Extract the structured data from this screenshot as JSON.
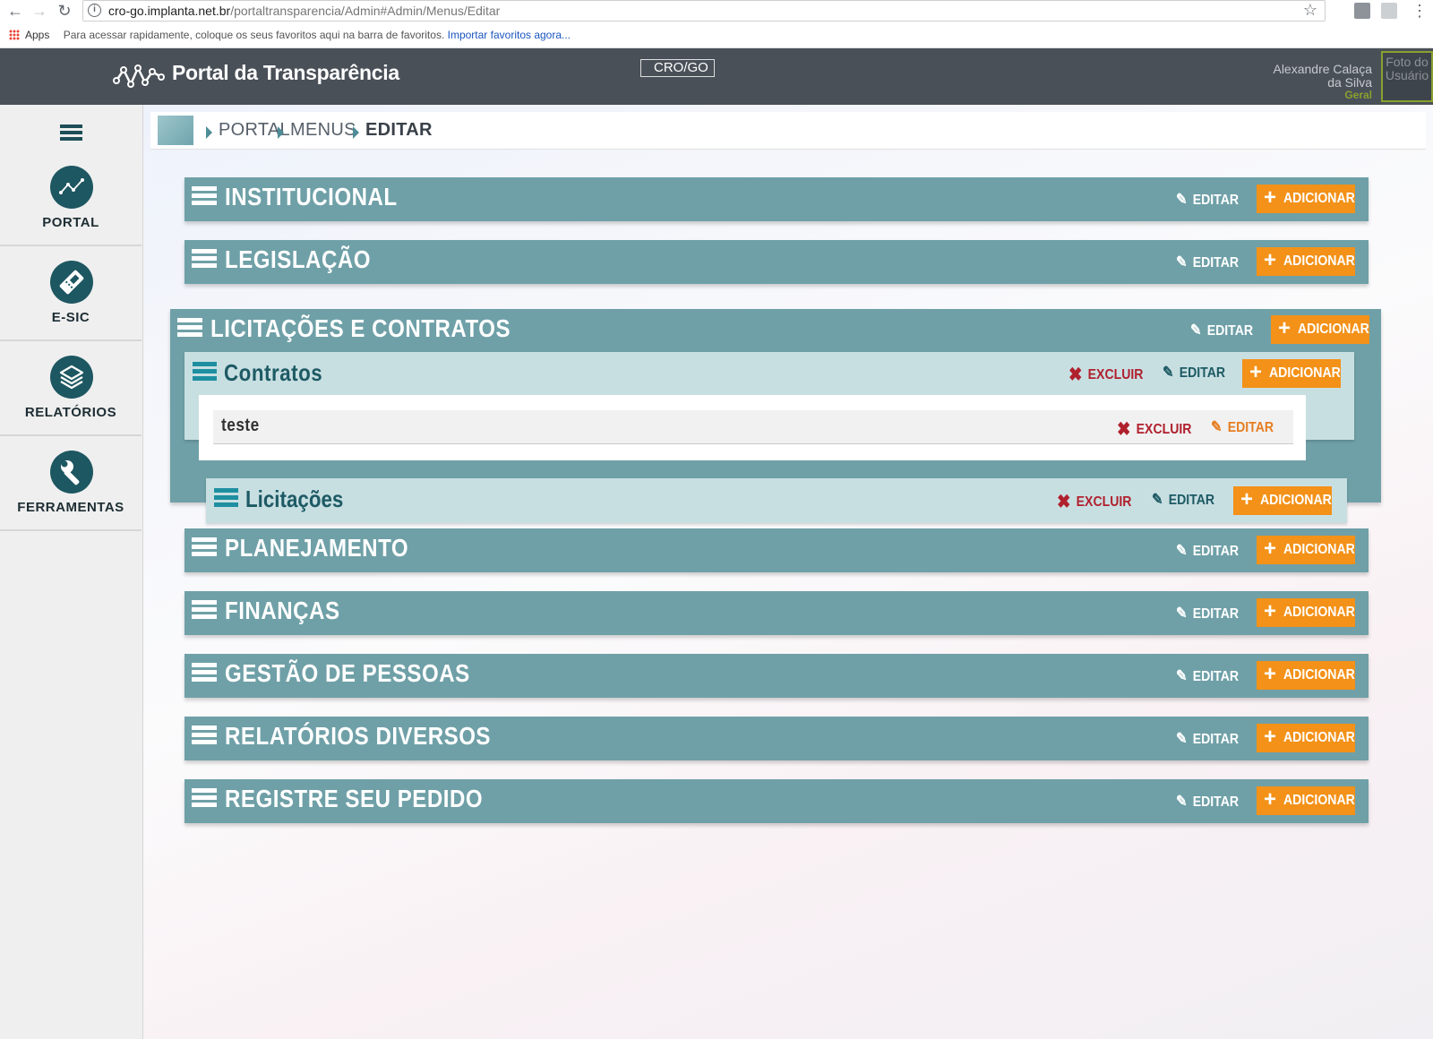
{
  "browser": {
    "url_host": "cro-go.implanta.net.br",
    "url_path": "/portaltransparencia/Admin#Admin/Menus/Editar",
    "bookmarks_apps": "Apps",
    "bookmarks_text": "Para acessar rapidamente, coloque os seus favoritos aqui na barra de favoritos.",
    "bookmarks_link": "Importar favoritos agora..."
  },
  "header": {
    "brand": "Portal da Transparência",
    "org_image_alt": "CRO/GO",
    "user_name_line1": "Alexandre Calaça",
    "user_name_line2": "da Silva",
    "user_role": "Geral",
    "avatar_alt": "Foto do Usuário"
  },
  "sidebar": {
    "items": [
      {
        "label": "PORTAL",
        "icon": "chart-line-icon"
      },
      {
        "label": "E-SIC",
        "icon": "ticket-icon"
      },
      {
        "label": "RELATÓRIOS",
        "icon": "layers-icon"
      },
      {
        "label": "FERRAMENTAS",
        "icon": "wrench-icon"
      }
    ]
  },
  "breadcrumb": [
    "PORTAL",
    "MENUS",
    "EDITAR"
  ],
  "labels": {
    "edit": "EDITAR",
    "add": "ADICIONAR",
    "delete": "EXCLUIR"
  },
  "menus": [
    {
      "title": "INSTITUCIONAL"
    },
    {
      "title": "LEGISLAÇÃO"
    },
    {
      "title": "LICITAÇÕES E CONTRATOS",
      "children": [
        {
          "title": "Contratos",
          "children": [
            {
              "title": "teste"
            }
          ]
        },
        {
          "title": "Licitações"
        }
      ]
    },
    {
      "title": "PLANEJAMENTO"
    },
    {
      "title": "FINANÇAS"
    },
    {
      "title": "GESTÃO DE PESSOAS"
    },
    {
      "title": "RELATÓRIOS DIVERSOS"
    },
    {
      "title": "REGISTRE SEU PEDIDO"
    }
  ],
  "colors": {
    "header_bg": "#4a5058",
    "menu_bar": "#6fa0a7",
    "submenu_bar": "#c8dfe2",
    "accent_orange": "#f39118",
    "delete_red": "#b0202d",
    "sidebar_icon": "#1d5761"
  }
}
